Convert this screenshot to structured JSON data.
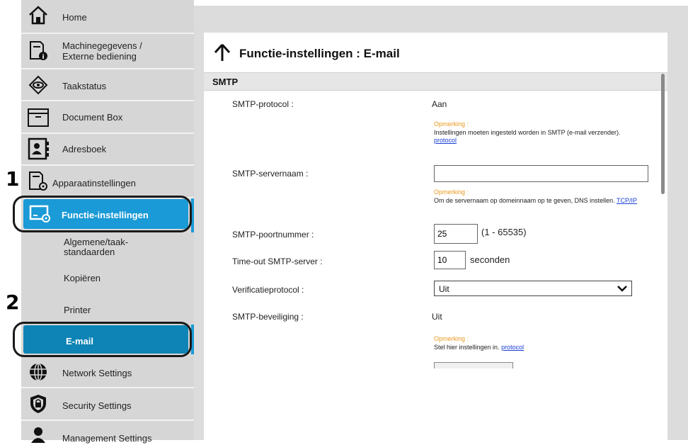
{
  "callouts": [
    "1",
    "2"
  ],
  "sidebar": {
    "items": [
      {
        "label": "Home",
        "icon": "home-icon"
      },
      {
        "label": "Machinegegevens /\nExterne bediening",
        "icon": "device-info-icon"
      },
      {
        "label": "Taakstatus",
        "icon": "eye-icon"
      },
      {
        "label": "Document Box",
        "icon": "box-icon"
      },
      {
        "label": "Adresboek",
        "icon": "address-book-icon"
      },
      {
        "label": "Apparaatinstellingen",
        "icon": "device-settings-icon"
      },
      {
        "label": "Functie-instellingen",
        "icon": "function-settings-icon",
        "active": true
      },
      {
        "label": "Network Settings",
        "icon": "globe-icon"
      },
      {
        "label": "Security Settings",
        "icon": "shield-icon"
      },
      {
        "label": "Management Settings",
        "icon": "person-icon"
      }
    ],
    "subitems": [
      {
        "label": "Algemene/taak-\nstandaarden"
      },
      {
        "label": "Kopiëren"
      },
      {
        "label": "Printer"
      },
      {
        "label": "E-mail",
        "active": true
      }
    ]
  },
  "panel": {
    "title": "Functie-instellingen : E-mail",
    "section": "SMTP",
    "fields": {
      "protocol_label": "SMTP-protocol :",
      "protocol_value": "Aan",
      "note1_heading": "Opmerking :",
      "note1_text": "Instellingen moeten ingesteld worden in SMTP (e-mail verzender).",
      "note1_link": "protocol",
      "server_label": "SMTP-servernaam :",
      "server_value": "",
      "note2_heading": "Opmerking :",
      "note2_text": "Om de servernaam op domeinnaam op te geven, DNS instellen.",
      "note2_link": "TCP/IP",
      "port_label": "SMTP-poortnummer :",
      "port_value": "25",
      "port_range": "(1 - 65535)",
      "timeout_label": "Time-out SMTP-server :",
      "timeout_value": "10",
      "timeout_unit": "seconden",
      "auth_label": "Verificatieprotocol :",
      "auth_value": "Uit",
      "security_label": "SMTP-beveiliging :",
      "security_value": "Uit",
      "note3_heading": "Opmerking :",
      "note3_text": "Stel hier instellingen in.",
      "note3_link": "protocol"
    }
  },
  "colors": {
    "sidebar_bg": "#d6d6d6",
    "active_blue": "#1a9ad6",
    "active_blue_dark": "#0d84b5",
    "note_orange": "#e99a1f",
    "link_blue": "#1a3fd6"
  }
}
